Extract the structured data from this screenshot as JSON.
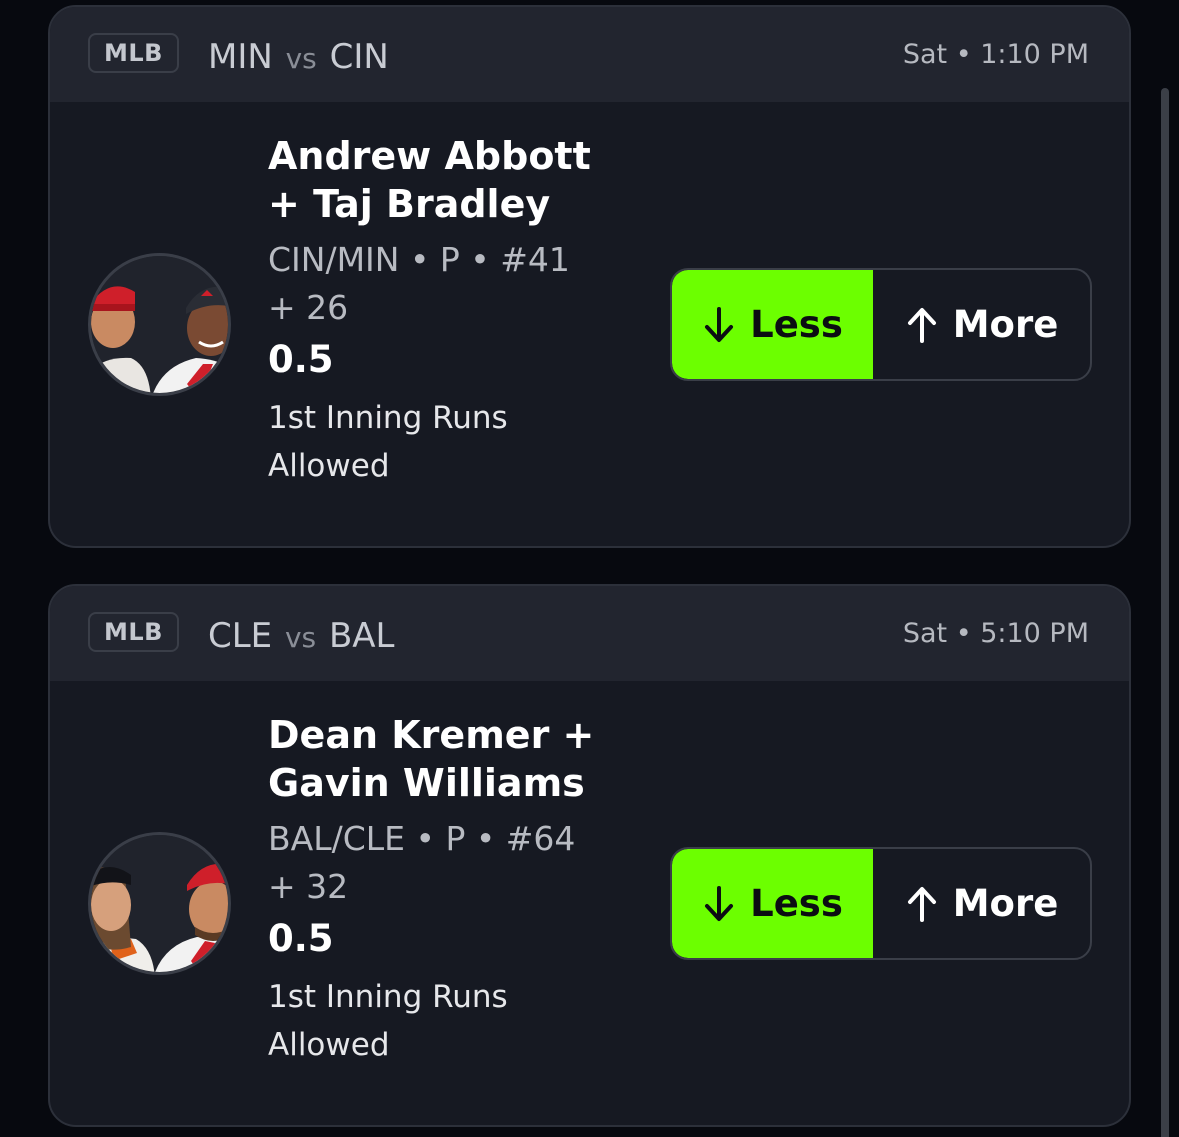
{
  "cards": [
    {
      "league": "MLB",
      "team_a": "MIN",
      "vs": "vs",
      "team_b": "CIN",
      "time": "Sat • 1:10 PM",
      "name_line1": "Andrew Abbott",
      "name_line2": "+ Taj Bradley",
      "meta_line1": "CIN/MIN • P • #41",
      "meta_line2": "+ 26",
      "line_value": "0.5",
      "stat_line1": "1st Inning Runs",
      "stat_line2": "Allowed",
      "less_label": "Less",
      "more_label": "More",
      "selected": "less"
    },
    {
      "league": "MLB",
      "team_a": "CLE",
      "vs": "vs",
      "team_b": "BAL",
      "time": "Sat • 5:10 PM",
      "name_line1": "Dean Kremer +",
      "name_line2": "Gavin Williams",
      "meta_line1": "BAL/CLE • P • #64",
      "meta_line2": "+ 32",
      "line_value": "0.5",
      "stat_line1": "1st Inning Runs",
      "stat_line2": "Allowed",
      "less_label": "Less",
      "more_label": "More",
      "selected": "less"
    }
  ],
  "icons": {
    "less": "arrow-down-icon",
    "more": "arrow-up-icon"
  },
  "colors": {
    "accent": "#6cff00",
    "card": "#161922",
    "header": "#22252f",
    "background": "#07090f"
  }
}
